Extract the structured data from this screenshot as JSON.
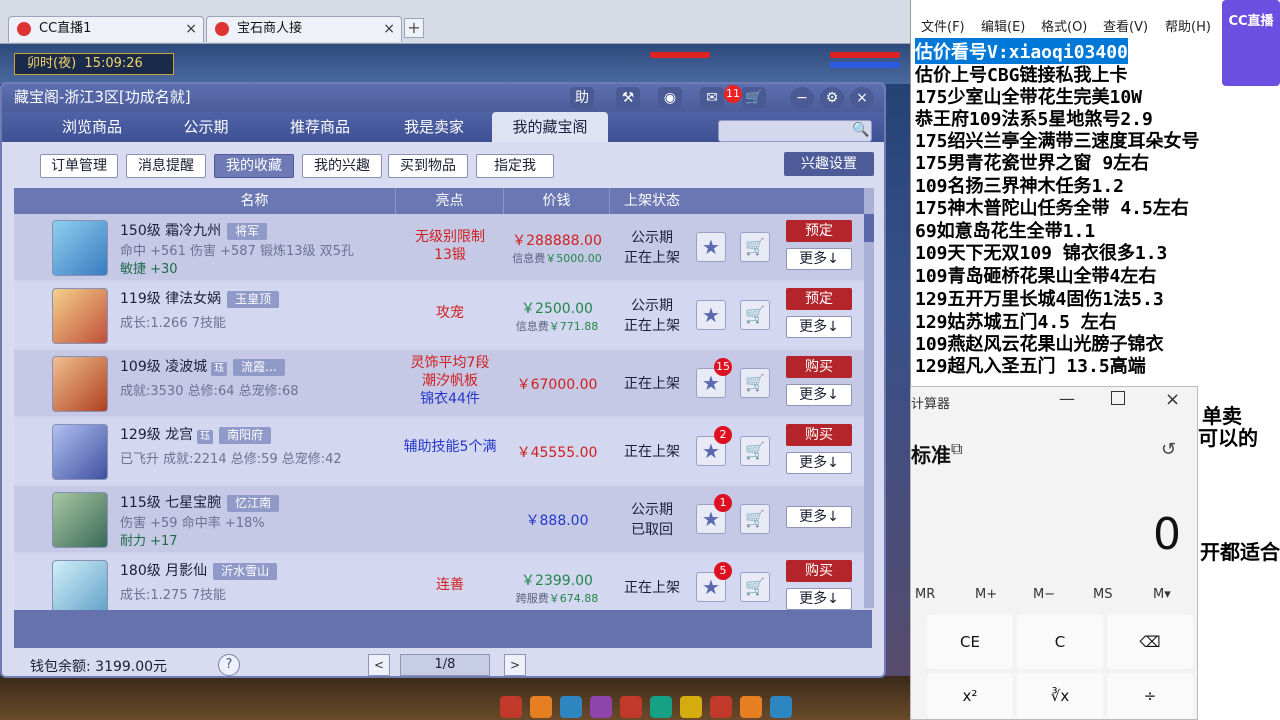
{
  "browser": {
    "tabs": [
      {
        "label": "CC直播1",
        "close": "×"
      },
      {
        "label": "宝石商人接",
        "close": "×"
      }
    ],
    "new_tab": "+"
  },
  "game": {
    "clock_label": "卯时(夜)",
    "clock_time": "15:09:26"
  },
  "window": {
    "title": "藏宝阁-浙江3区[功成名就]",
    "help_label": "助",
    "notif_count": "11",
    "nav_tabs": [
      "浏览商品",
      "公示期",
      "推荐商品",
      "我是卖家",
      "我的藏宝阁"
    ],
    "active_nav": "我的藏宝阁",
    "search_placeholder": "",
    "sub_buttons": [
      "订单管理",
      "消息提醒",
      "我的收藏",
      "我的兴趣",
      "买到物品",
      "指定我"
    ],
    "active_sub": "我的收藏",
    "interest_button": "兴趣设置",
    "columns": [
      "名称",
      "亮点",
      "价钱",
      "上架状态"
    ],
    "rows": [
      {
        "name": "150级 霜冷九州",
        "tag": "将军",
        "line2": "命中 +561 伤害 +587 锻炼13级 双5孔",
        "line3": "敏捷 +30",
        "highlight": [
          "无级别限制",
          "13锻"
        ],
        "price": "￥288888.00",
        "fee_label": "信息费",
        "fee_value": "￥5000.00",
        "status": [
          "公示期",
          "正在上架"
        ],
        "star_count": "",
        "action": "预定",
        "more": "更多↓"
      },
      {
        "name": "119级 律法女娲",
        "tag": "玉皇顶",
        "line2": "成长:1.266 7技能",
        "highlight": [
          "攻宠"
        ],
        "price": "￥2500.00",
        "fee_label": "信息费",
        "fee_value": "￥771.88",
        "status": [
          "公示期",
          "正在上架"
        ],
        "star_count": "",
        "action": "预定",
        "more": "更多↓"
      },
      {
        "name": "109级 凌波城",
        "tag_small": "珏",
        "tag": "流霞...",
        "line2": "成就:3530 总修:64 总宠修:68",
        "highlight": [
          "灵饰平均7段",
          "潮汐帆板",
          "锦衣44件"
        ],
        "price": "￥67000.00",
        "status": [
          "正在上架"
        ],
        "star_count": "15",
        "action": "购买",
        "more": "更多↓"
      },
      {
        "name": "129级 龙宫",
        "tag_small": "珏",
        "tag": "南阳府",
        "line2": "已飞升 成就:2214 总修:59 总宠修:42",
        "highlight": [
          "辅助技能5个满"
        ],
        "price": "￥45555.00",
        "status": [
          "正在上架"
        ],
        "star_count": "2",
        "action": "购买",
        "more": "更多↓"
      },
      {
        "name": "115级 七星宝腕",
        "tag": "忆江南",
        "line2": "伤害 +59 命中率 +18%",
        "line3": "耐力 +17",
        "highlight": [],
        "price": "￥888.00",
        "status": [
          "公示期",
          "已取回"
        ],
        "star_count": "1",
        "action": "",
        "more": "更多↓"
      },
      {
        "name": "180级 月影仙",
        "tag": "沂水雪山",
        "line2": "成长:1.275 7技能",
        "highlight": [
          "连善"
        ],
        "price": "￥2399.00",
        "fee_label": "跨服费",
        "fee_value": "￥674.88",
        "status": [
          "正在上架"
        ],
        "star_count": "5",
        "action": "购买",
        "more": "更多↓"
      }
    ],
    "wallet": "钱包余额: 3199.00元",
    "help_icon": "?",
    "page": "1/8",
    "prev": "<",
    "next": ">"
  },
  "notepad": {
    "menu": [
      "文件(F)",
      "编辑(E)",
      "格式(O)",
      "查看(V)",
      "帮助(H)"
    ],
    "selected_line": "估价看号V:xiaoqi03400",
    "lines": [
      "估价上号CBG链接私我上卡",
      "175少室山全带花生完美10W",
      "恭王府109法系5星地煞号2.9",
      "175绍兴兰亭全满带三速度耳朵女号",
      "175男青花瓷世界之窗  9左右",
      "109名扬三界神木任务1.2",
      "175神木普陀山任务全带 4.5左右",
      "69如意岛花生全带1.1",
      "109天下无双109  锦衣很多1.3",
      "109青岛砸桥花果山全带4左右",
      "129五开万里长城4固伤1法5.3",
      "129姑苏城五门4.5 左右",
      "109燕赵风云花果山光膀子锦衣",
      "129超凡入圣五门  13.5高端"
    ],
    "right_fragments": [
      "单卖",
      "可以的",
      "开都适合"
    ]
  },
  "logo": {
    "text": "CC直播"
  },
  "calculator": {
    "title": "计算器",
    "mode": "标准",
    "display": "0",
    "memory": [
      "MR",
      "M+",
      "M−",
      "MS",
      "M▾"
    ],
    "keys_row1": [
      "CE",
      "C",
      "⌫"
    ],
    "keys_row2": [
      "x²",
      "∛x",
      "÷"
    ],
    "minimize": "—",
    "close": "×"
  }
}
